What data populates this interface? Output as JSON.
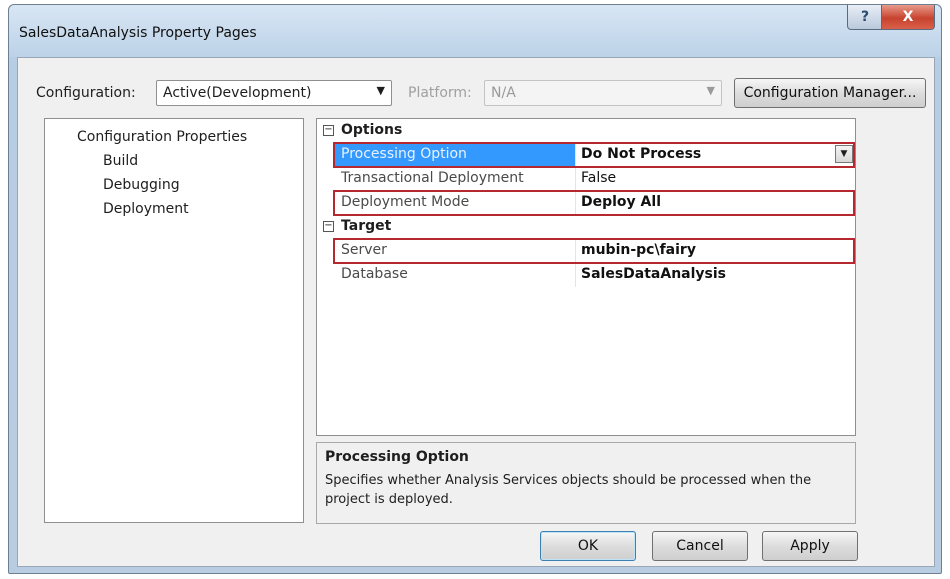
{
  "window": {
    "title": "SalesDataAnalysis Property Pages"
  },
  "titlebar": {
    "help_label": "?",
    "close_label": "X"
  },
  "toolbar": {
    "configuration_label": "Configuration:",
    "configuration_value": "Active(Development)",
    "platform_label": "Platform:",
    "platform_value": "N/A",
    "configuration_manager_label": "Configuration Manager..."
  },
  "tree": {
    "root": "Configuration Properties",
    "items": [
      "Build",
      "Debugging",
      "Deployment"
    ],
    "selected": "Deployment"
  },
  "properties": {
    "options": {
      "label": "Options",
      "rows": [
        {
          "name": "Processing Option",
          "value": "Do Not Process"
        },
        {
          "name": "Transactional Deployment",
          "value": "False"
        },
        {
          "name": "Deployment Mode",
          "value": "Deploy All"
        }
      ]
    },
    "target": {
      "label": "Target",
      "rows": [
        {
          "name": "Server",
          "value": "mubin-pc\\fairy"
        },
        {
          "name": "Database",
          "value": "SalesDataAnalysis"
        }
      ]
    }
  },
  "description": {
    "title": "Processing Option",
    "text": "Specifies whether Analysis Services objects should be processed when the project is deployed."
  },
  "buttons": {
    "ok": "OK",
    "cancel": "Cancel",
    "apply": "Apply"
  },
  "colors": {
    "selection": "#3399ff",
    "highlight_border": "#b5282f"
  }
}
